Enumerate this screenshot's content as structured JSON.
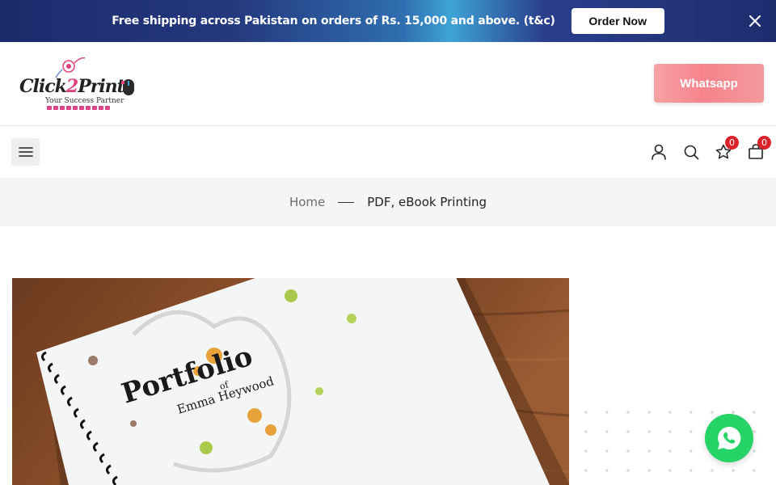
{
  "announcement": {
    "text": "Free shipping across Pakistan on orders of Rs. 15,000 and above. (t&c)",
    "button_label": "Order Now",
    "close_icon": "close-icon"
  },
  "header": {
    "logo": {
      "brand_prefix": "Click",
      "brand_number": "2",
      "brand_suffix": "Print",
      "tagline": "Your Success Partner"
    },
    "whatsapp_label": "Whatsapp"
  },
  "nav": {
    "menu_icon": "hamburger-menu-icon",
    "account_icon": "user-icon",
    "search_icon": "search-icon",
    "wishlist_icon": "star-icon",
    "wishlist_count": "0",
    "cart_icon": "shopping-bag-icon",
    "cart_count": "0"
  },
  "breadcrumb": {
    "home": "Home",
    "current": "PDF, eBook Printing"
  },
  "product": {
    "image_title": "Portfolio",
    "image_of": "of",
    "image_name": "Emma Heywood"
  },
  "floating": {
    "whatsapp_icon": "whatsapp-icon"
  },
  "colors": {
    "accent_badge": "#d8232a",
    "whatsapp_green": "#25d366",
    "whatsapp_button": "#f7838c",
    "topbar": "#1e2c6e"
  }
}
